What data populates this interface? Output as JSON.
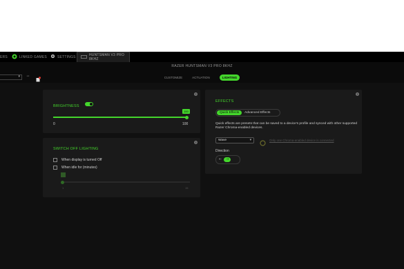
{
  "tabs": {
    "partial_label": "ERS",
    "linked_games": "LINKED GAMES",
    "settings": "SETTINGS",
    "active_device": "HUNTSMAN V3 PRO 8KHZ"
  },
  "device": {
    "title": "RAZER HUNTSMAN V3 PRO 8KHZ",
    "nav": [
      "CUSTOMIZE",
      "ACTUATION",
      "LIGHTING"
    ],
    "active_nav": "LIGHTING"
  },
  "brightness": {
    "title": "BRIGHTNESS",
    "value": "100",
    "min": "0",
    "max": "100",
    "percent": 100
  },
  "switch_off": {
    "title": "SWITCH OFF LIGHTING",
    "option1": "When display is turned Off",
    "option2": "When idle for (minutes)",
    "slider_min": "1",
    "slider_max": "15"
  },
  "effects": {
    "title": "EFFECTS",
    "tab_quick": "Quick Effects",
    "tab_advanced": "Advanced Effects",
    "description": "Quick effects are presets that can be saved to a device's profile and synced with other supported Razer Chroma-enabled devices.",
    "selected": "Wave",
    "sync_text": "Only one Chroma-enabled device is connected",
    "direction_label": "Direction"
  },
  "colors": {
    "accent": "#44d62c",
    "panel": "#1a1a1a",
    "background": "#101010"
  }
}
